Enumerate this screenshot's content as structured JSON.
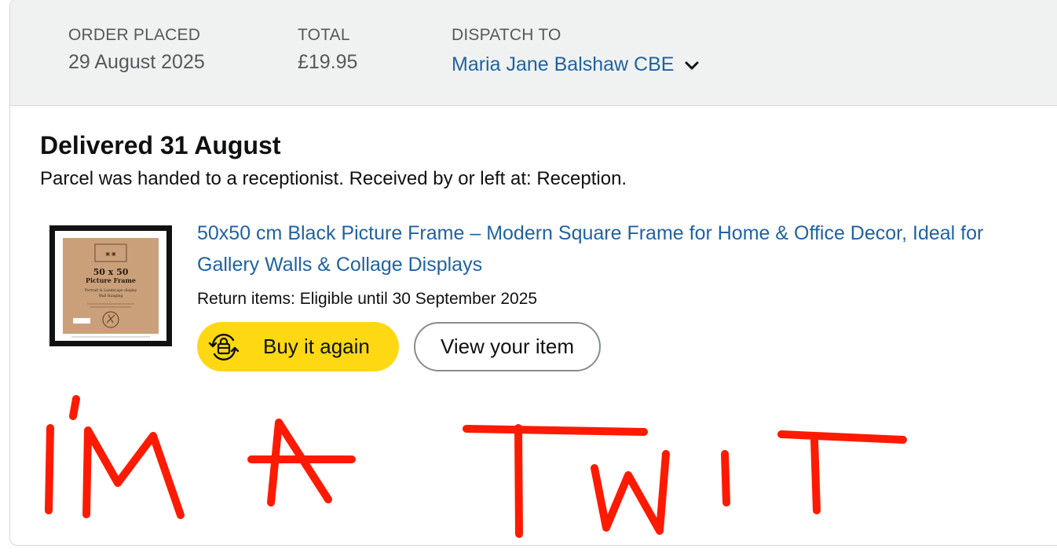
{
  "order": {
    "placed_label": "ORDER PLACED",
    "placed_value": "29 August 2025",
    "total_label": "TOTAL",
    "total_value": "£19.95",
    "dispatch_label": "DISPATCH TO",
    "dispatch_value": "Maria Jane Balshaw CBE"
  },
  "delivery": {
    "title": "Delivered 31 August",
    "subtitle": "Parcel was handed to a receptionist. Received by or left at: Reception."
  },
  "item": {
    "title": "50x50 cm Black Picture Frame – Modern Square Frame for Home & Office Decor, Ideal for Gallery Walls & Collage Displays",
    "return_info": "Return items: Eligible until 30 September 2025",
    "thumbnail_text": {
      "size": "50 x 50",
      "name": "Picture Frame",
      "line1": "Portrait & Landscape display",
      "line2": "Wall Hanging"
    }
  },
  "actions": {
    "buy_again": "Buy it again",
    "view_item": "View your item"
  },
  "annotation": {
    "handwritten_text": "I'M A TWIT",
    "color": "#ff1a00"
  },
  "colors": {
    "link": "#2162a1",
    "header_bg": "#f0f2f2",
    "buy_button": "#ffd814"
  }
}
